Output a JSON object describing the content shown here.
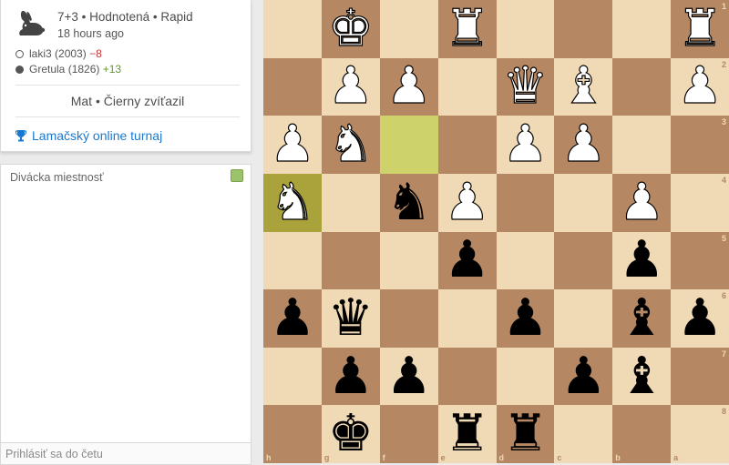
{
  "game": {
    "icon": "rabbit-icon",
    "meta": "7+3 • Hodnotená • Rapid",
    "time_ago": "18 hours ago",
    "players": [
      {
        "color": "white",
        "name": "laki3",
        "rating": "(2003)",
        "diff": "−8"
      },
      {
        "color": "black",
        "name": "Gretula",
        "rating": "(1826)",
        "diff": "+13"
      }
    ],
    "result": "Mat • Čierny zvíťazil",
    "tournament": "Lamačský online turnaj",
    "tournament_icon": "trophy-icon"
  },
  "chat": {
    "title": "Divácka miestnosť",
    "placeholder": "Prihlásiť sa do četu"
  },
  "board": {
    "orientation": "black",
    "rank_labels": [
      "1",
      "2",
      "3",
      "4",
      "5",
      "6",
      "7",
      "8"
    ],
    "file_labels": [
      "h",
      "g",
      "f",
      "e",
      "d",
      "c",
      "b",
      "a"
    ],
    "last_move": [
      "h4",
      "f3"
    ],
    "rows": [
      [
        "",
        "wK",
        "",
        "wR",
        "",
        "",
        "",
        "wR"
      ],
      [
        "",
        "wP",
        "wP",
        "",
        "wQ",
        "wB",
        "",
        "wP"
      ],
      [
        "wP",
        "wN",
        "",
        "",
        "wP",
        "wP",
        "",
        ""
      ],
      [
        "wN",
        "",
        "bN",
        "wP",
        "",
        "",
        "wP",
        ""
      ],
      [
        "",
        "",
        "",
        "bP",
        "",
        "",
        "bP",
        ""
      ],
      [
        "bP",
        "bQ",
        "",
        "",
        "bP",
        "",
        "bB",
        "bP"
      ],
      [
        "",
        "bP",
        "bP",
        "",
        "",
        "bP",
        "bB",
        ""
      ],
      [
        "",
        "bK",
        "",
        "bR",
        "bR",
        "",
        "",
        ""
      ]
    ],
    "colors": {
      "light": "#f0d9b5",
      "dark": "#b58863",
      "highlight_light": "#cdd26a",
      "highlight_dark": "#aaa23a"
    }
  }
}
